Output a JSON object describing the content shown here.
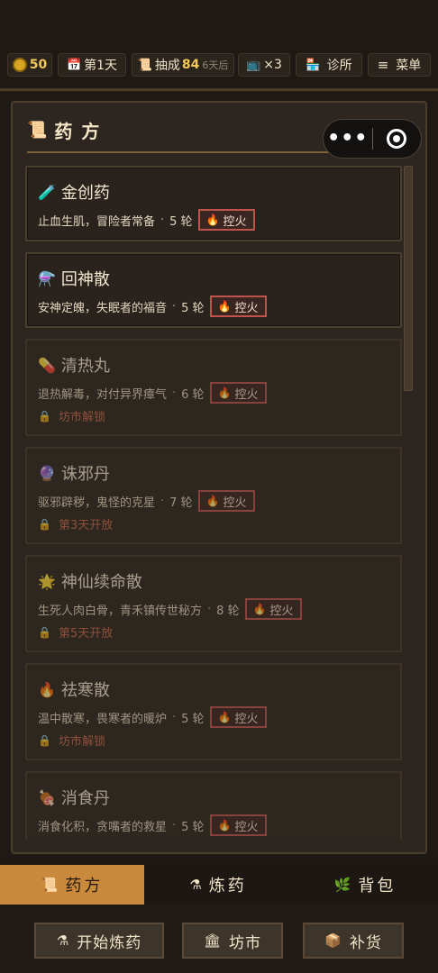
{
  "topbar": {
    "coins": "50",
    "day": "第1天",
    "commission_label": "抽成",
    "commission_value": "84",
    "commission_note": "6天后",
    "speed": "×3",
    "clinic_label": "诊所",
    "menu_label": "菜单"
  },
  "panel": {
    "title": "药方"
  },
  "capsule": {
    "more": "•••"
  },
  "badge_label": "控火",
  "recipes": [
    {
      "icon": "🧪",
      "name": "金创药",
      "desc": "止血生肌，冒险者常备",
      "rounds": "5 轮",
      "locked": false,
      "lock_text": ""
    },
    {
      "icon": "⚗️",
      "name": "回神散",
      "desc": "安神定魄，失眠者的福音",
      "rounds": "5 轮",
      "locked": false,
      "lock_text": ""
    },
    {
      "icon": "💊",
      "name": "清热丸",
      "desc": "退热解毒，对付异界瘴气",
      "rounds": "6 轮",
      "locked": true,
      "lock_text": "坊市解锁"
    },
    {
      "icon": "🔮",
      "name": "诛邪丹",
      "desc": "驱邪辟秽，鬼怪的克星",
      "rounds": "7 轮",
      "locked": true,
      "lock_text": "第3天开放"
    },
    {
      "icon": "🌟",
      "name": "神仙续命散",
      "desc": "生死人肉白骨，青禾镇传世秘方",
      "rounds": "8 轮",
      "locked": true,
      "lock_text": "第5天开放"
    },
    {
      "icon": "🔥",
      "name": "祛寒散",
      "desc": "温中散寒，畏寒者的暖炉",
      "rounds": "5 轮",
      "locked": true,
      "lock_text": "坊市解锁"
    },
    {
      "icon": "🍖",
      "name": "消食丹",
      "desc": "消食化积，贪嘴者的救星",
      "rounds": "5 轮",
      "locked": true,
      "lock_text": ""
    }
  ],
  "tabs": [
    {
      "label": "药方",
      "active": true
    },
    {
      "label": "炼药",
      "active": false
    },
    {
      "label": "背包",
      "active": false
    }
  ],
  "actions": {
    "start": "开始炼药",
    "market": "坊市",
    "restock": "补货"
  }
}
